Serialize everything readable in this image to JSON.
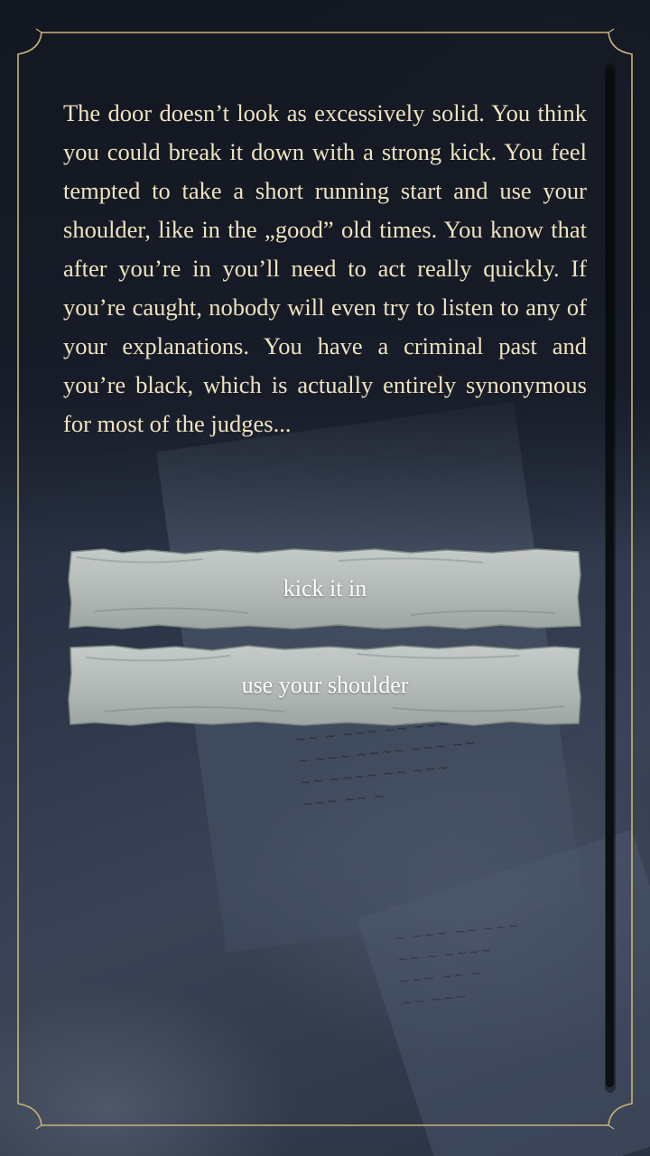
{
  "story": {
    "text": "The door doesn’t look as excessively solid. You think you could break it down with a strong kick. You feel tempted to take a short running start and use your shoulder, like in the „good” old times. You know that after you’re in you’ll need to act really quickly. If you’re caught, nobody will even try to listen to any of your explanations. You have a criminal past and you’re black, which is actually entirely synonymous for most of the judges..."
  },
  "choices": [
    {
      "label": "kick it in"
    },
    {
      "label": "use your shoulder"
    }
  ],
  "colors": {
    "story_text": "#efe3bf",
    "frame_gold": "#c9b47a",
    "button_stone": "#b9c0bd",
    "button_text": "#ffffff"
  },
  "icons": {
    "frame": "ornate-frame-border",
    "button": "torn-parchment-button"
  }
}
